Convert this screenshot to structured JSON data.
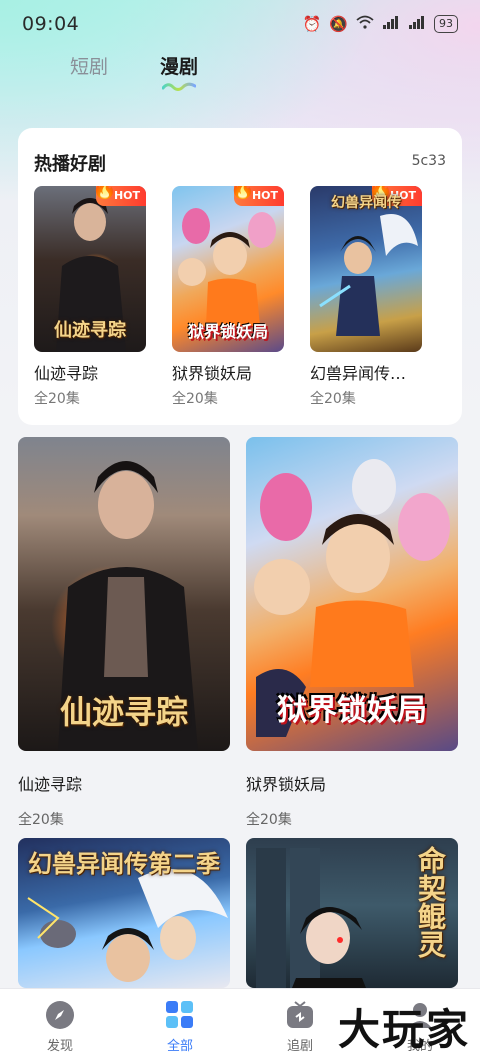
{
  "status_bar": {
    "time": "09:04",
    "icons": [
      "alarm-icon",
      "mute-icon",
      "wifi-icon",
      "signal-icon",
      "signal-icon"
    ],
    "battery": "93"
  },
  "tabs": [
    {
      "label": "短剧",
      "active": false
    },
    {
      "label": "漫剧",
      "active": true
    }
  ],
  "hot_section": {
    "title": "热播好剧",
    "count": "5c33",
    "badge": "HOT",
    "items": [
      {
        "name": "仙迹寻踪",
        "episodes": "全20集",
        "cover_text": "仙迹寻踪"
      },
      {
        "name": "狱界锁妖局",
        "episodes": "全20集",
        "cover_text": "狱界锁妖局"
      },
      {
        "name": "幻兽异闻传…",
        "episodes": "全20集",
        "cover_text": "幻兽异闻传"
      }
    ]
  },
  "grid": {
    "items": [
      {
        "name": "仙迹寻踪",
        "episodes": "全20集",
        "cover_text": "仙迹寻踪"
      },
      {
        "name": "狱界锁妖局",
        "episodes": "全20集",
        "cover_text": "狱界锁妖局"
      },
      {
        "name": "",
        "episodes": "",
        "cover_text": "幻兽异闻传第二季"
      },
      {
        "name": "",
        "episodes": "",
        "cover_text": "命契鲲灵"
      }
    ]
  },
  "bottom_nav": [
    {
      "label": "发现",
      "icon": "compass-icon",
      "active": false
    },
    {
      "label": "全部",
      "icon": "grid-icon",
      "active": true
    },
    {
      "label": "追剧",
      "icon": "tv-icon",
      "active": false
    },
    {
      "label": "我的",
      "icon": "user-icon",
      "active": false
    }
  ],
  "watermark": "大玩家",
  "colors": {
    "accent": "#3b7cf7",
    "hot_badge": "#ff3b2f"
  }
}
